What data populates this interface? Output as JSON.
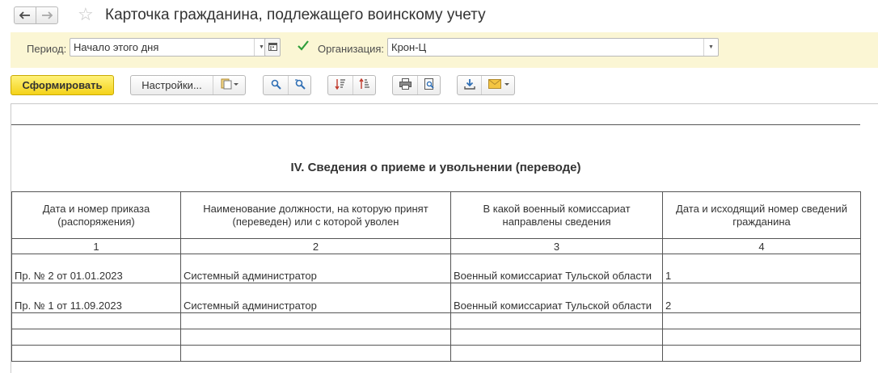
{
  "window": {
    "title": "Карточка гражданина, подлежащего воинскому учету"
  },
  "filters": {
    "period_label": "Период:",
    "period_value": "Начало этого дня",
    "organization_checked": true,
    "organization_label": "Организация:",
    "organization_value": "Крон-Ц"
  },
  "toolbar": {
    "generate_label": "Сформировать",
    "settings_label": "Настройки..."
  },
  "report": {
    "section_title": "IV. Сведения о приеме и увольнении (переводе)",
    "columns": [
      "Дата и номер приказа (распоряжения)",
      "Наименование должности, на которую принят (переведен) или с которой уволен",
      "В какой военный комиссариат направлены сведения",
      "Дата и исходящий номер сведений гражданина"
    ],
    "column_numbers": [
      "1",
      "2",
      "3",
      "4"
    ],
    "rows": [
      [
        "Пр. № 2 от 01.01.2023",
        "Системный администратор",
        "Военный комиссариат Тульской области",
        "1"
      ],
      [
        "Пр. № 1 от 11.09.2023",
        "Системный администратор",
        "Военный комиссариат Тульской области",
        "2"
      ]
    ]
  },
  "colors": {
    "filter_bar_bg": "#fbf6d4",
    "primary_button": "#f4d21a",
    "check_green": "#2f9e3a"
  },
  "icons": [
    "back-arrow-icon",
    "forward-arrow-icon",
    "favorite-star-icon",
    "dropdown-arrow-icon",
    "calendar-icon",
    "checkbox-icon",
    "variants-icon",
    "search-icon",
    "search-next-icon",
    "sort-desc-icon",
    "sort-asc-icon",
    "print-icon",
    "print-preview-icon",
    "save-icon",
    "mail-icon"
  ]
}
